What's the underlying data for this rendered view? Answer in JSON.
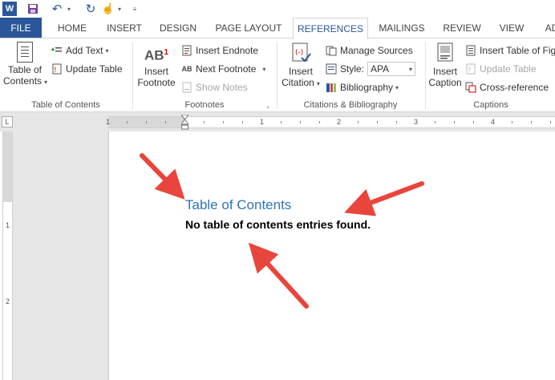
{
  "quick_access": {
    "app_logo": "W",
    "icons": [
      "word-icon",
      "save-icon",
      "undo-icon",
      "redo-icon",
      "touch-mode-icon",
      "customize-icon"
    ]
  },
  "tabs": [
    "FILE",
    "HOME",
    "INSERT",
    "DESIGN",
    "PAGE LAYOUT",
    "REFERENCES",
    "MAILINGS",
    "REVIEW",
    "VIEW",
    "AD"
  ],
  "active_tab": "REFERENCES",
  "ribbon": {
    "toc_group": {
      "label": "Table of Contents",
      "toc_button_line1": "Table of",
      "toc_button_line2": "Contents",
      "add_text": "Add Text",
      "update_table": "Update Table"
    },
    "footnotes_group": {
      "label": "Footnotes",
      "ab_glyph": "AB",
      "insert_footnote_line1": "Insert",
      "insert_footnote_line2": "Footnote",
      "insert_endnote": "Insert Endnote",
      "next_footnote": "Next Footnote",
      "show_notes": "Show Notes"
    },
    "citations_group": {
      "label": "Citations & Bibliography",
      "insert_citation_line1": "Insert",
      "insert_citation_line2": "Citation",
      "manage_sources": "Manage Sources",
      "style_label": "Style:",
      "style_value": "APA",
      "bibliography": "Bibliography"
    },
    "captions_group": {
      "label": "Captions",
      "insert_caption_line1": "Insert",
      "insert_caption_line2": "Caption",
      "insert_table_of_figures": "Insert Table of Fig",
      "update_table": "Update Table",
      "cross_reference": "Cross-reference"
    }
  },
  "ruler": {
    "corner_glyph": "L",
    "numbers": [
      "1",
      "1",
      "2",
      "3",
      "4"
    ],
    "vertical_numbers": [
      "1",
      "2"
    ]
  },
  "document": {
    "toc_heading": "Table of Contents",
    "toc_message": "No table of contents entries found."
  },
  "colors": {
    "accent": "#2b579a",
    "heading": "#2e74b5",
    "arrow": "#e8453c"
  }
}
